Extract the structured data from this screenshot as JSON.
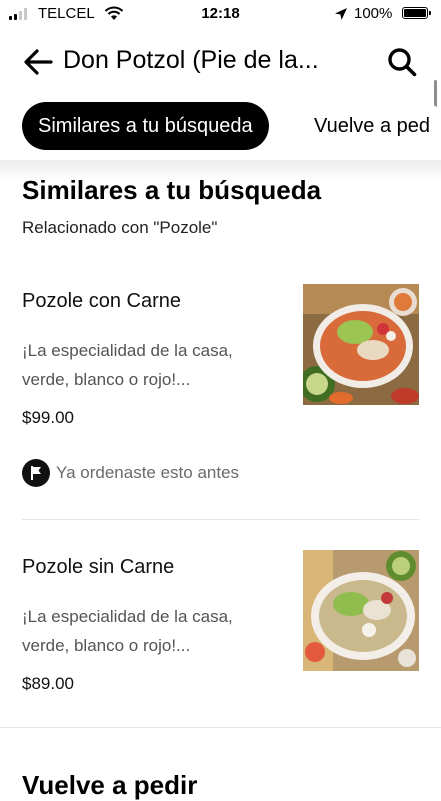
{
  "status_bar": {
    "carrier": "TELCEL",
    "time": "12:18",
    "battery": "100%"
  },
  "header": {
    "title": "Don Potzol (Pie de la...",
    "back_icon": "arrow-left-icon",
    "search_icon": "search-icon"
  },
  "tabs": [
    {
      "label": "Similares a tu búsqueda",
      "active": true
    },
    {
      "label": "Vuelve a ped",
      "active": false
    }
  ],
  "section": {
    "title": "Similares a tu búsqueda",
    "subtitle": "Relacionado con \"Pozole\""
  },
  "items": [
    {
      "name": "Pozole con Carne",
      "description_line1": "¡La especialidad de la casa,",
      "description_line2": "verde, blanco o rojo!...",
      "price": "$99.00",
      "reorder_label": "Ya ordenaste esto antes"
    },
    {
      "name": "Pozole sin Carne",
      "description_line1": "¡La especialidad de la casa,",
      "description_line2": "verde, blanco o rojo!...",
      "price": "$89.00"
    }
  ],
  "next_section": {
    "title": "Vuelve a pedir"
  },
  "colors": {
    "accent": "#000000",
    "muted_text": "#545454",
    "divider": "#e4e4e4"
  }
}
